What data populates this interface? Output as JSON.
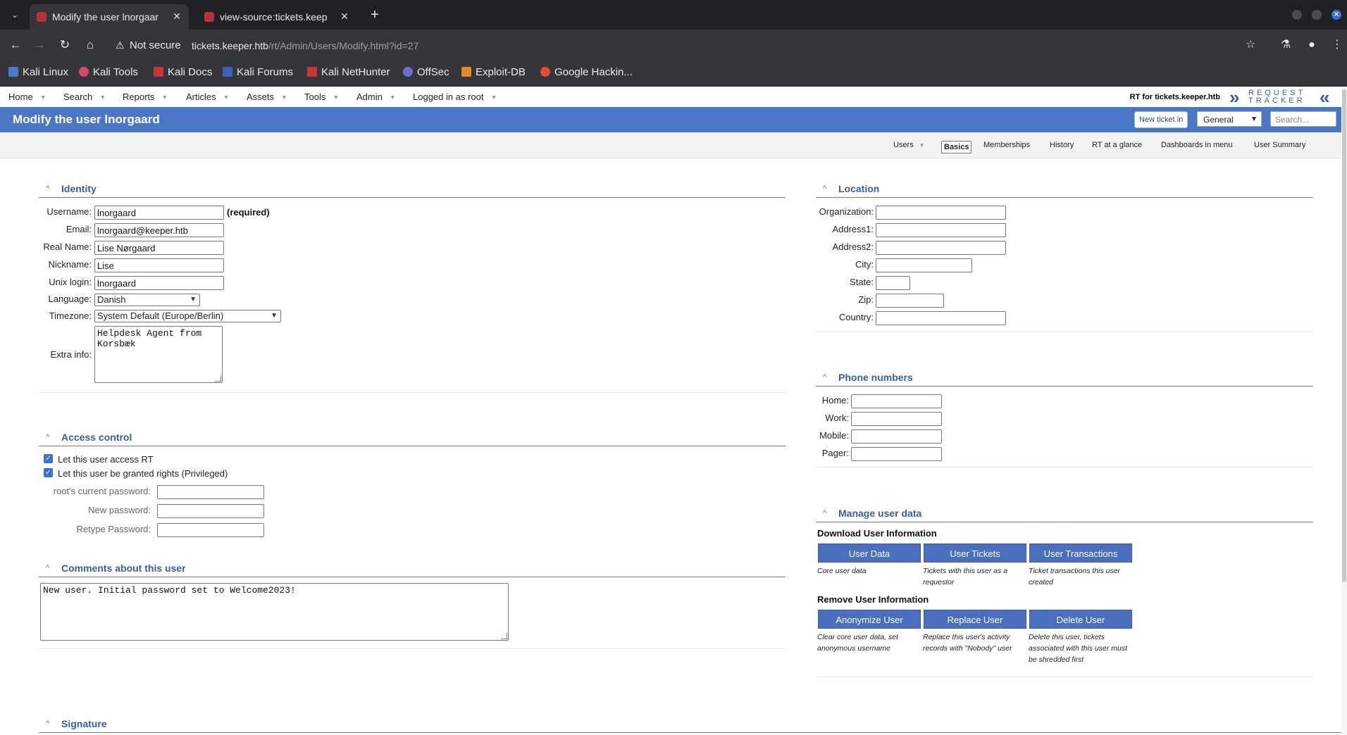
{
  "browser": {
    "tabs": [
      {
        "title": "Modify the user lnorgaar",
        "active": true
      },
      {
        "title": "view-source:tickets.keep",
        "active": false
      }
    ],
    "security_label": "Not secure",
    "url_host": "tickets.keeper.htb",
    "url_path": "/rt/Admin/Users/Modify.html?id=27",
    "bookmarks": [
      "Kali Linux",
      "Kali Tools",
      "Kali Docs",
      "Kali Forums",
      "Kali NetHunter",
      "OffSec",
      "Exploit-DB",
      "Google Hackin..."
    ]
  },
  "rt": {
    "nav": [
      "Home",
      "Search",
      "Reports",
      "Articles",
      "Assets",
      "Tools",
      "Admin",
      "Logged in as root"
    ],
    "rt_for": "RT for tickets.keeper.htb",
    "logo_line1": "REQUEST",
    "logo_line2": "TRACKER",
    "page_title": "Modify the user lnorgaard",
    "new_ticket_label": "New ticket in",
    "queue_value": "General",
    "search_placeholder": "Search...",
    "subnav": [
      "Users",
      "Basics",
      "Memberships",
      "History",
      "RT at a glance",
      "Dashboards in menu",
      "User Summary"
    ]
  },
  "identity": {
    "title": "Identity",
    "username_label": "Username:",
    "username": "lnorgaard",
    "required": "(required)",
    "email_label": "Email:",
    "email": "lnorgaard@keeper.htb",
    "realname_label": "Real Name:",
    "realname": "Lise Nørgaard",
    "nickname_label": "Nickname:",
    "nickname": "Lise",
    "unixlogin_label": "Unix login:",
    "unixlogin": "lnorgaard",
    "language_label": "Language:",
    "language": "Danish",
    "timezone_label": "Timezone:",
    "timezone": "System Default (Europe/Berlin)",
    "extrainfo_label": "Extra info:",
    "extrainfo": "Helpdesk Agent from\nKorsbæk"
  },
  "access": {
    "title": "Access control",
    "rt_access_label": "Let this user access RT",
    "privileged_label": "Let this user be granted rights (Privileged)",
    "current_pw_label": "root's current password:",
    "new_pw_label": "New password:",
    "retype_pw_label": "Retype Password:"
  },
  "comments": {
    "title": "Comments about this user",
    "text": "New user. Initial password set to Welcome2023!"
  },
  "signature": {
    "title": "Signature"
  },
  "location": {
    "title": "Location",
    "organization_label": "Organization:",
    "address1_label": "Address1:",
    "address2_label": "Address2:",
    "city_label": "City:",
    "state_label": "State:",
    "zip_label": "Zip:",
    "country_label": "Country:"
  },
  "phones": {
    "title": "Phone numbers",
    "home_label": "Home:",
    "work_label": "Work:",
    "mobile_label": "Mobile:",
    "pager_label": "Pager:"
  },
  "userdata": {
    "title": "Manage user data",
    "download_heading": "Download User Information",
    "user_data_btn": "User Data",
    "user_data_hint": "Core user data",
    "user_tickets_btn": "User Tickets",
    "user_tickets_hint": "Tickets with this user as a requestor",
    "user_tx_btn": "User Transactions",
    "user_tx_hint": "Ticket transactions this user created",
    "remove_heading": "Remove User Information",
    "anonymize_btn": "Anonymize User",
    "anonymize_hint": "Clear core user data, set anonymous username",
    "replace_btn": "Replace User",
    "replace_hint": "Replace this user's activity records with \"Nobody\" user",
    "delete_btn": "Delete User",
    "delete_hint": "Delete this user, tickets associated with this user must be shredded first"
  },
  "colors": {
    "titlebar": "#4a77c5",
    "section_title": "#3a5d9c",
    "button": "#4a6fbf",
    "chrome_dark": "#202124"
  }
}
